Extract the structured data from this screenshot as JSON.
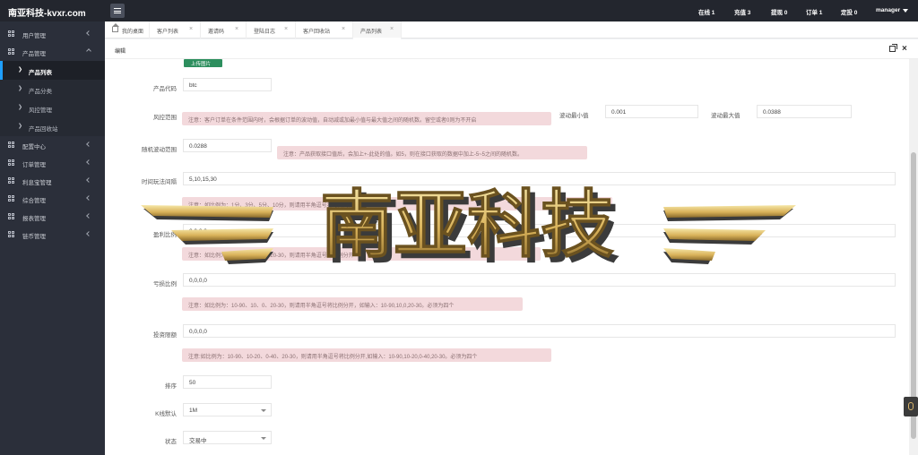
{
  "app": {
    "brand": "南亚科技-kvxr.com"
  },
  "topbar": {
    "stats": [
      {
        "label": "在线 1"
      },
      {
        "label": "充值 3"
      },
      {
        "label": "提现 0"
      },
      {
        "label": "订单 1"
      },
      {
        "label": "定投 0"
      }
    ],
    "user": "manager"
  },
  "sidebar": {
    "items": [
      {
        "label": "用户管理",
        "expanded": false
      },
      {
        "label": "产品管理",
        "expanded": true
      }
    ],
    "product_sub": [
      {
        "label": "产品列表",
        "active": true
      },
      {
        "label": "产品分类",
        "active": false
      },
      {
        "label": "风控管理",
        "active": false
      },
      {
        "label": "产品回收站",
        "active": false
      }
    ],
    "items_after": [
      {
        "label": "配置中心"
      },
      {
        "label": "订单管理"
      },
      {
        "label": "利息宝管理"
      },
      {
        "label": "综合管理"
      },
      {
        "label": "报表管理"
      },
      {
        "label": "链币管理"
      }
    ]
  },
  "tabs": [
    {
      "label": "我的桌面",
      "active": false
    },
    {
      "label": "客户列表",
      "active": false
    },
    {
      "label": "邀请码",
      "active": false
    },
    {
      "label": "登陆日志",
      "active": false
    },
    {
      "label": "客户回收站",
      "active": false
    },
    {
      "label": "产品列表",
      "active": true
    }
  ],
  "page": {
    "subtitle": "编辑"
  },
  "form": {
    "upload_label": "上传图片",
    "product_code": {
      "label": "产品代码",
      "value": "btc"
    },
    "risk_range": {
      "label": "风控范围",
      "note": "注意：客户订单在条件范围内时，会根据订单的波动值，自动减或加最小值与最大值之间的随机数。留空或者0则为不开启",
      "min_label": "波动最小值",
      "min_value": "0.001",
      "max_label": "波动最大值",
      "max_value": "0.0388"
    },
    "random_range": {
      "label": "随机波动范围",
      "value": "0.0288",
      "note": "注意：产品获取接口值后，会加上+-此处的值。如5，则在接口获取的数据中加上-5~5之间的随机数。"
    },
    "time_interval": {
      "label": "时间玩法间隔",
      "value": "5,10,15,30",
      "note": "注意：如比例为：1分、3分、5分、10分，则请用半角逗号将时间间隔隔开"
    },
    "profit_ratio": {
      "label": "盈利比例",
      "value": "0,0,0,0",
      "note": "注意：如比例为：10-90、10、0、20-30，则请用半角逗号将比例分开"
    },
    "loss_ratio": {
      "label": "亏损比例",
      "value": "0,0,0,0",
      "note": "注意：如比例为：10-90、10、0、20-30，则请用半角逗号将比例分开，如输入：10-90,10,0,20-30。必须为四个"
    },
    "invest_limit": {
      "label": "投资限额",
      "value": "0,0,0,0",
      "note": "注意:如比例为：10-90、10-20、0-40、20-30，则请用半角逗号将比例分开,如输入：10-90,10-20,0-40,20-30。必须为四个"
    },
    "sort": {
      "label": "排序",
      "value": "50"
    },
    "kline_default": {
      "label": "K线默认",
      "value": "1M"
    },
    "status": {
      "label": "状态",
      "value": "交易中"
    }
  },
  "watermark": {
    "text": "南亚科技",
    "colors": {
      "gold": "#d9b25a",
      "dark": "#3b3b3b",
      "highlight": "#f6e7a8"
    }
  },
  "colors": {
    "sidebar": "#2b2f3a",
    "topbar": "#23262e",
    "accent": "#1e9fff",
    "note_bg": "#f3d9dc",
    "upload_btn": "#2d8f5e"
  }
}
